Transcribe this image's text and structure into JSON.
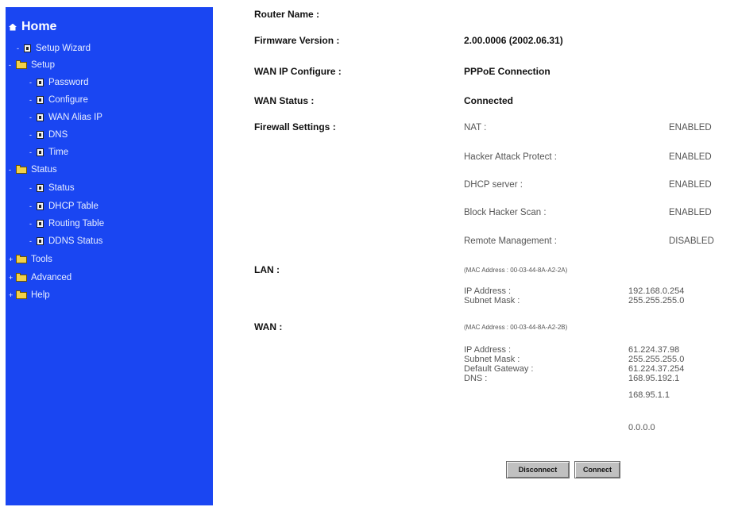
{
  "sidebar": {
    "home": "Home",
    "setup_wizard": "Setup Wizard",
    "setup": "Setup",
    "password": "Password",
    "configure": "Configure",
    "wan_alias_ip": "WAN Alias IP",
    "dns": "DNS",
    "time": "Time",
    "status": "Status",
    "status_item": "Status",
    "dhcp_table": "DHCP Table",
    "routing_table": "Routing Table",
    "ddns_status": "DDNS Status",
    "tools": "Tools",
    "advanced": "Advanced",
    "help": "Help"
  },
  "info": {
    "router_name_label": "Router Name :",
    "router_name_value": "",
    "firmware_label": "Firmware Version :",
    "firmware_value": "2.00.0006 (2002.06.31)",
    "wan_ip_label": "WAN IP Configure :",
    "wan_ip_value": "PPPoE Connection",
    "wan_status_label": "WAN Status :",
    "wan_status_value": "Connected",
    "firewall_label": "Firewall Settings :"
  },
  "firewall": [
    {
      "name": "NAT :",
      "state": "ENABLED"
    },
    {
      "name": "Hacker Attack Protect :",
      "state": "ENABLED"
    },
    {
      "name": "DHCP server :",
      "state": "ENABLED"
    },
    {
      "name": "Block Hacker Scan :",
      "state": "ENABLED"
    },
    {
      "name": "Remote Management :",
      "state": "DISABLED"
    }
  ],
  "lan": {
    "label": "LAN :",
    "mac": "(MAC Address : 00-03-44-8A-A2-2A)",
    "ip_label": "IP Address :",
    "ip_value": "192.168.0.254",
    "mask_label": "Subnet Mask :",
    "mask_value": "255.255.255.0"
  },
  "wan": {
    "label": "WAN :",
    "mac": "(MAC Address : 00-03-44-8A-A2-2B)",
    "ip_label": "IP Address :",
    "ip_value": "61.224.37.98",
    "mask_label": "Subnet Mask :",
    "mask_value": "255.255.255.0",
    "gateway_label": "Default Gateway :",
    "gateway_value": "61.224.37.254",
    "dns_label": "DNS :",
    "dns_1": "168.95.192.1",
    "dns_2": "168.95.1.1",
    "dns_3": "0.0.0.0"
  },
  "buttons": {
    "disconnect": "Disconnect",
    "connect": "Connect"
  }
}
